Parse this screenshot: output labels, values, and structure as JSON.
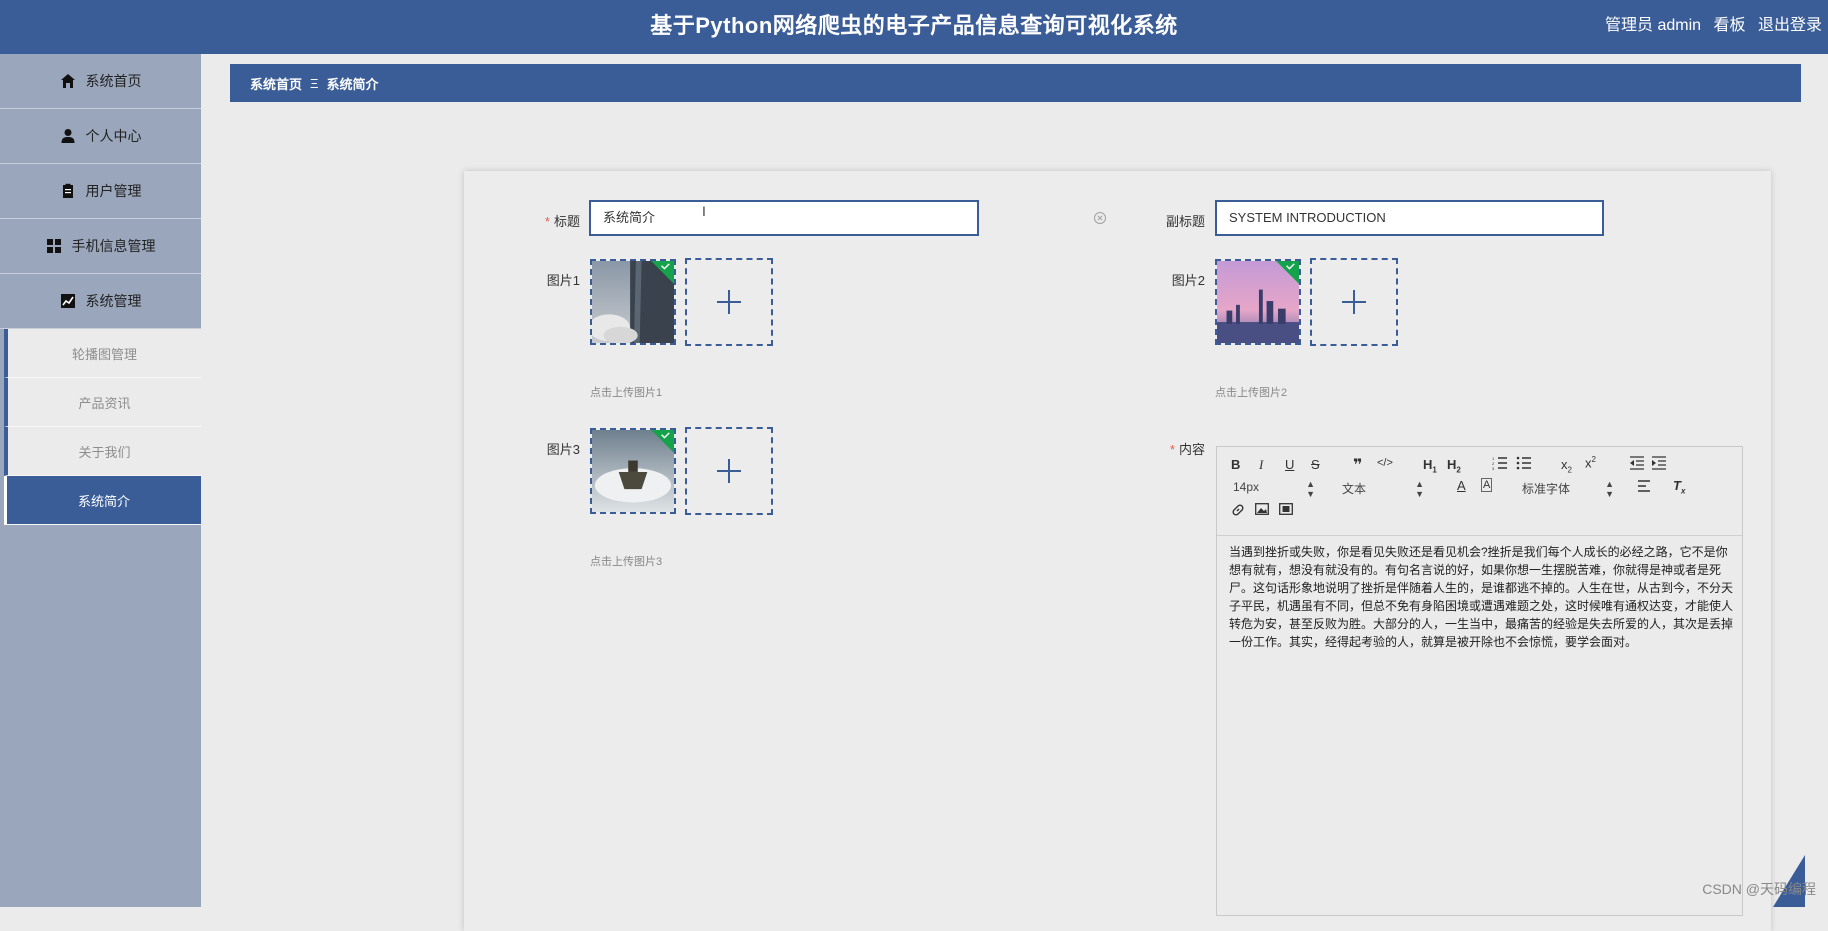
{
  "header": {
    "title": "基于Python网络爬虫的电子产品信息查询可视化系统",
    "user_label": "管理员 admin",
    "dashboard_link": "看板",
    "logout_link": "退出登录"
  },
  "sidebar": {
    "items": [
      {
        "label": "系统首页",
        "icon": "home-icon"
      },
      {
        "label": "个人中心",
        "icon": "user-icon"
      },
      {
        "label": "用户管理",
        "icon": "clipboard-icon"
      },
      {
        "label": "手机信息管理",
        "icon": "grid-icon"
      },
      {
        "label": "系统管理",
        "icon": "chart-icon"
      }
    ],
    "subitems": [
      {
        "label": "轮播图管理",
        "active": false
      },
      {
        "label": "产品资讯",
        "active": false
      },
      {
        "label": "关于我们",
        "active": false
      },
      {
        "label": "系统简介",
        "active": true
      }
    ]
  },
  "breadcrumb": {
    "home": "系统首页",
    "separator": "Ξ",
    "current": "系统简介"
  },
  "form": {
    "title_label": "标题",
    "title_value": "系统简介",
    "subtitle_label": "副标题",
    "subtitle_value": "SYSTEM INTRODUCTION",
    "image1_label": "图片1",
    "image1_hint": "点击上传图片1",
    "image2_label": "图片2",
    "image2_hint": "点击上传图片2",
    "image3_label": "图片3",
    "image3_hint": "点击上传图片3",
    "content_label": "内容",
    "required_mark": "*"
  },
  "editor": {
    "font_size": "14px",
    "block_format": "文本",
    "font_family": "标准字体",
    "content": "当遇到挫折或失败，你是看见失败还是看见机会?挫折是我们每个人成长的必经之路，它不是你想有就有，想没有就没有的。有句名言说的好，如果你想一生摆脱苦难，你就得是神或者是死尸。这句话形象地说明了挫折是伴随着人生的，是谁都逃不掉的。人生在世，从古到今，不分天子平民，机遇虽有不同，但总不免有身陷困境或遭遇难题之处，这时候唯有通权达变，才能使人转危为安，甚至反败为胜。大部分的人，一生当中，最痛苦的经验是失去所爱的人，其次是丢掉一份工作。其实，经得起考验的人，就算是被开除也不会惊慌，要学会面对。"
  },
  "watermark": "CSDN @天码编程",
  "colors": {
    "primary": "#3a5d98",
    "sidebar": "#9aa6bb",
    "background": "#ebebeb",
    "required": "#e25b4b"
  }
}
